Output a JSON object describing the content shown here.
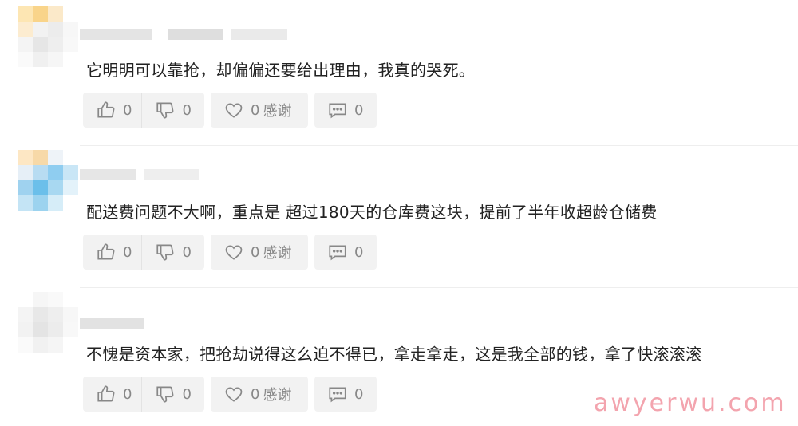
{
  "comments": [
    {
      "text": "它明明可以靠抢，却偏偏还要给出理由，我真的哭死。",
      "like_count": "0",
      "dislike_count": "0",
      "thanks_count": "0",
      "thanks_label": "感谢",
      "reply_count": "0"
    },
    {
      "text": "配送费问题不大啊，重点是 超过180天的仓库费这块，提前了半年收超龄仓储费",
      "like_count": "0",
      "dislike_count": "0",
      "thanks_count": "0",
      "thanks_label": "感谢",
      "reply_count": "0"
    },
    {
      "text": "不愧是资本家，把抢劫说得这么迫不得已，拿走拿走，这是我全部的钱，拿了快滚滚滚",
      "like_count": "0",
      "dislike_count": "0",
      "thanks_count": "0",
      "thanks_label": "感谢",
      "reply_count": "0"
    }
  ],
  "watermark": "awyerwu.com",
  "colors": {
    "muted_text": "#888888",
    "button_bg": "#f2f2f2",
    "watermark": "#f3a4ae"
  }
}
